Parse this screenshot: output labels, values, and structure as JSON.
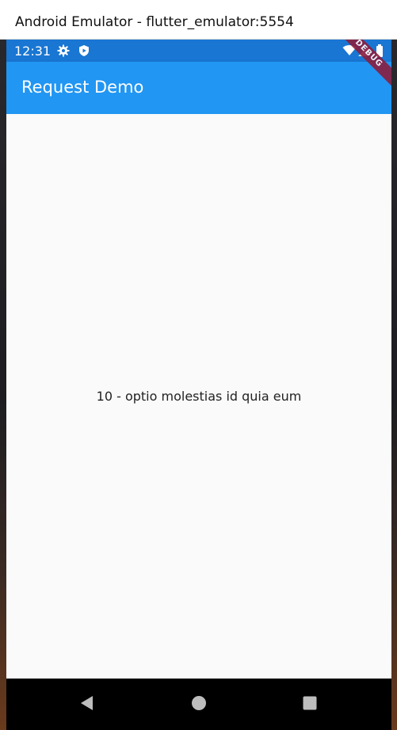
{
  "window": {
    "title": "Android Emulator - flutter_emulator:5554"
  },
  "statusbar": {
    "time": "12:31",
    "icons_left": [
      "gear-icon",
      "play-protect-icon"
    ],
    "icons_right": [
      "wifi-icon",
      "signal-icon",
      "battery-icon"
    ]
  },
  "appbar": {
    "title": "Request Demo"
  },
  "content": {
    "text": "10 - optio molestias id quia eum"
  },
  "debug_banner": {
    "label": "DEBUG"
  },
  "navbar": {
    "buttons": [
      "back-icon",
      "home-icon",
      "recents-icon"
    ]
  },
  "colors": {
    "statusbar": "#1976d2",
    "appbar": "#2196f3",
    "background": "#fafafa",
    "navbar": "#000000",
    "debug_ribbon": "#8b1e3f"
  }
}
